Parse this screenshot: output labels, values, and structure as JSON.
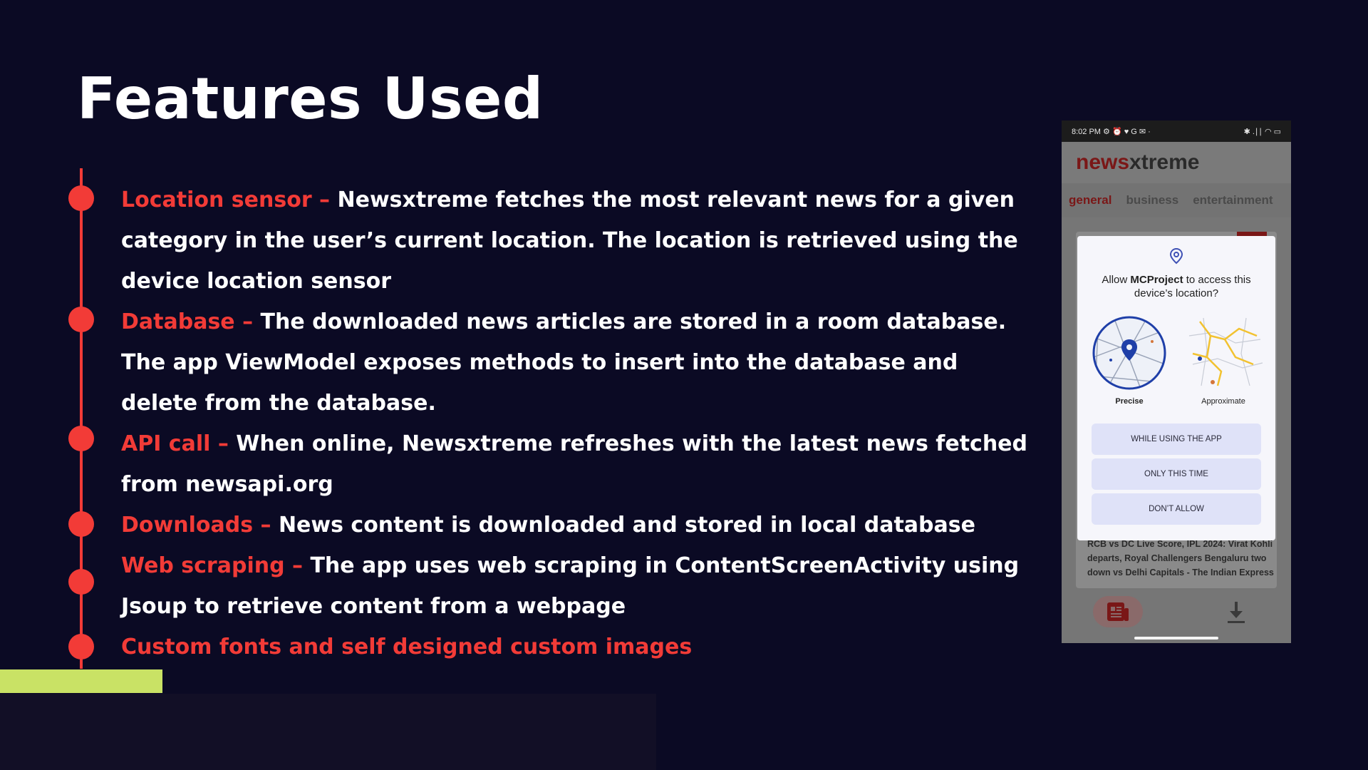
{
  "slide": {
    "title": "Features Used",
    "features": [
      {
        "label": "Location sensor –",
        "text": " Newsxtreme fetches the most relevant news for a given category in the user’s current location. The location is retrieved using the device location sensor"
      },
      {
        "label": "Database –",
        "text": " The downloaded news articles are stored in a room database. The app ViewModel exposes methods to insert into the database and delete from the database."
      },
      {
        "label": "API call –",
        "text": " When online, Newsxtreme refreshes with the latest news fetched from newsapi.org"
      },
      {
        "label": "Downloads –",
        "text": " News content is downloaded and stored in local database"
      },
      {
        "label": "Web scraping –",
        "text": " The app uses web scraping in ContentScreenActivity using Jsoup to retrieve content from a webpage"
      },
      {
        "label": "Custom fonts and self designed custom images",
        "text": ""
      }
    ],
    "colors": {
      "background": "#0b0a24",
      "accent": "#f23b37",
      "highlight": "#c9e265"
    }
  },
  "phone": {
    "status": {
      "time": "8:02 PM",
      "left_icons": "⚙ ⏰ ♥ G ✉ ·",
      "right_icons": "✱ .∣∣ ◠ ▭"
    },
    "app": {
      "brand_news": "news",
      "brand_xtreme": "xtreme"
    },
    "tabs": [
      "general",
      "business",
      "entertainment"
    ],
    "headline": "RCB vs DC Live Score, IPL 2024: Virat Kohli departs, Royal Challengers Bengaluru two down vs Delhi Capitals - The Indian Express",
    "dialog": {
      "prefix": "Allow ",
      "app_name": "MCProject",
      "suffix": " to access this device’s location?",
      "precise_label": "Precise",
      "approximate_label": "Approximate",
      "buttons": [
        "WHILE USING THE APP",
        "ONLY THIS TIME",
        "DON’T ALLOW"
      ]
    },
    "icons": [
      "location-pin-icon",
      "newspaper-icon",
      "download-icon"
    ]
  }
}
